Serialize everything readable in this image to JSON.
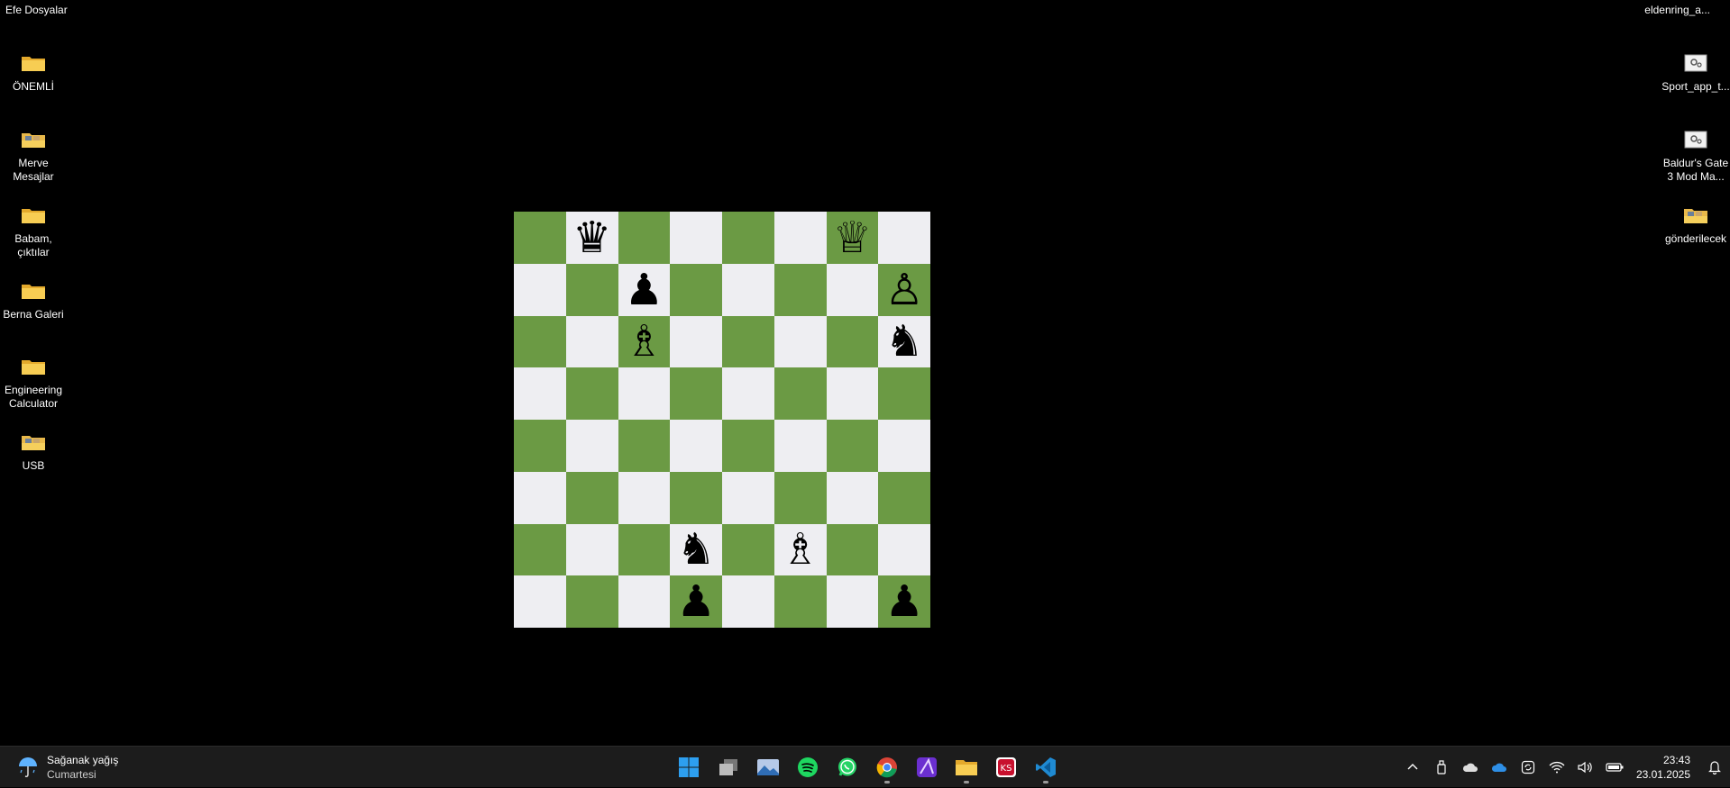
{
  "desktop": {
    "top_left_label": "Efe Dosyalar",
    "top_right_label": "eldenring_a...",
    "left_icons": [
      {
        "label": "ÖNEMLİ",
        "icon": "folder-icon"
      },
      {
        "label": "Merve Mesajlar",
        "icon": "folder-images-icon"
      },
      {
        "label": "Babam, çıktılar",
        "icon": "folder-icon"
      },
      {
        "label": "Berna Galeri",
        "icon": "folder-icon"
      },
      {
        "label": "Engineering Calculator",
        "icon": "folder-icon"
      },
      {
        "label": "USB",
        "icon": "folder-images-icon"
      }
    ],
    "right_icons": [
      {
        "label": "Sport_app_t...",
        "icon": "settings-file-icon"
      },
      {
        "label": "Baldur's Gate 3 Mod Ma...",
        "icon": "settings-file-icon"
      },
      {
        "label": "gönderilecek",
        "icon": "folder-images-icon"
      }
    ]
  },
  "chess": {
    "colors": {
      "light": "#eeeef2",
      "dark": "#6b9a44"
    },
    "pieces": [
      {
        "square": "b8",
        "glyph": "♛",
        "name": "black-queen"
      },
      {
        "square": "g8",
        "glyph": "♕",
        "name": "white-queen"
      },
      {
        "square": "c7",
        "glyph": "♟",
        "name": "black-pawn"
      },
      {
        "square": "h7",
        "glyph": "♙",
        "name": "white-pawn"
      },
      {
        "square": "c6",
        "glyph": "♗",
        "name": "white-bishop"
      },
      {
        "square": "h6",
        "glyph": "♞",
        "name": "black-knight"
      },
      {
        "square": "d2",
        "glyph": "♞",
        "name": "black-knight"
      },
      {
        "square": "f2",
        "glyph": "♗",
        "name": "white-bishop"
      },
      {
        "square": "d1",
        "glyph": "♟",
        "name": "black-pawn"
      },
      {
        "square": "h1",
        "glyph": "♟",
        "name": "black-pawn"
      }
    ]
  },
  "taskbar": {
    "weather": {
      "title": "Sağanak yağış",
      "subtitle": "Cumartesi",
      "icon": "rain-umbrella-icon"
    },
    "apps": [
      {
        "name": "start-button",
        "icon": "windows-logo-icon",
        "running": false
      },
      {
        "name": "task-view-button",
        "icon": "task-view-icon",
        "running": false
      },
      {
        "name": "photos-app",
        "icon": "photos-icon",
        "running": false
      },
      {
        "name": "spotify-app",
        "icon": "spotify-icon",
        "running": false
      },
      {
        "name": "whatsapp-app",
        "icon": "whatsapp-icon",
        "running": false
      },
      {
        "name": "chrome-app",
        "icon": "chrome-icon",
        "running": true
      },
      {
        "name": "affinity-app",
        "icon": "affinity-icon",
        "running": false
      },
      {
        "name": "file-explorer-app",
        "icon": "folder-icon",
        "running": true
      },
      {
        "name": "recorder-app",
        "icon": "recorder-icon",
        "running": false
      },
      {
        "name": "vscode-app",
        "icon": "vscode-icon",
        "running": true
      }
    ],
    "tray": [
      "chevron-up-icon",
      "usb-drive-icon",
      "cloud-icon",
      "onedrive-icon",
      "sync-icon",
      "wifi-icon",
      "speaker-icon",
      "battery-icon"
    ],
    "time": "23:43",
    "date": "23.01.2025"
  }
}
